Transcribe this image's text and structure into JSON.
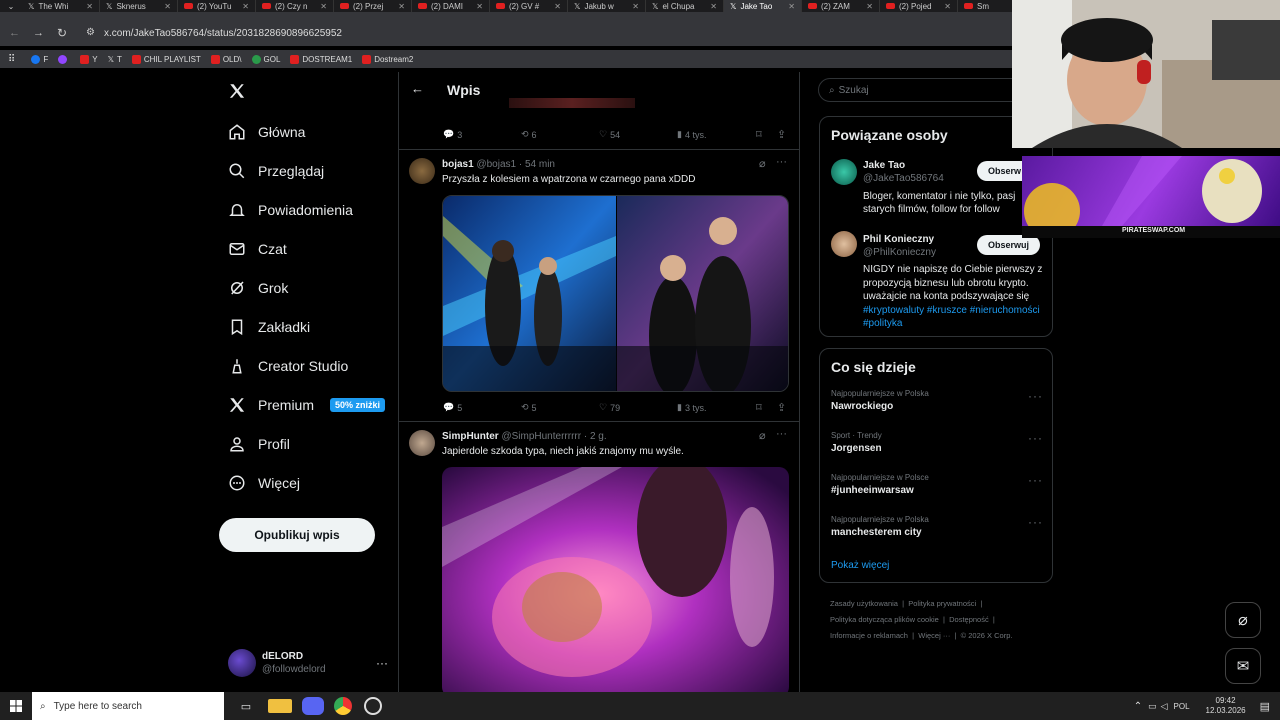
{
  "browser": {
    "tabs": [
      {
        "label": "The Whi",
        "icon": "x-icon"
      },
      {
        "label": "Sknerus",
        "icon": "x-icon"
      },
      {
        "label": "(2) YouTu",
        "icon": "youtube-icon"
      },
      {
        "label": "(2) Czy n",
        "icon": "youtube-icon"
      },
      {
        "label": "(2) Przej",
        "icon": "youtube-icon"
      },
      {
        "label": "(2) DAMI",
        "icon": "youtube-icon"
      },
      {
        "label": "(2) GV #",
        "icon": "youtube-icon"
      },
      {
        "label": "Jakub w",
        "icon": "x-icon"
      },
      {
        "label": "el Chupa",
        "icon": "x-icon"
      },
      {
        "label": "Jake Tao",
        "icon": "x-icon",
        "active": true
      },
      {
        "label": "(2) ZAM",
        "icon": "youtube-icon"
      },
      {
        "label": "(2) Pojed",
        "icon": "youtube-icon"
      },
      {
        "label": "Sm",
        "icon": "youtube-icon"
      }
    ],
    "url": "x.com/JakeTao586764/status/2031828690896625952",
    "bookmarks": [
      {
        "label": "F",
        "icon": "facebook-icon"
      },
      {
        "label": "",
        "icon": "twitch-icon"
      },
      {
        "label": "Y",
        "icon": "youtube-icon"
      },
      {
        "label": "T",
        "icon": "x-icon"
      },
      {
        "label": "CHIL PLAYLIST",
        "icon": "youtube-icon"
      },
      {
        "label": "OLD\\",
        "icon": "youtube-icon"
      },
      {
        "label": "GOL",
        "icon": "gol-icon"
      },
      {
        "label": "DOSTREAM1",
        "icon": "youtube-icon"
      },
      {
        "label": "Dostream2",
        "icon": "youtube-icon"
      }
    ]
  },
  "nav": {
    "items": [
      {
        "label": "Główna",
        "icon": "home-icon"
      },
      {
        "label": "Przeglądaj",
        "icon": "search-icon"
      },
      {
        "label": "Powiadomienia",
        "icon": "bell-icon"
      },
      {
        "label": "Czat",
        "icon": "mail-icon"
      },
      {
        "label": "Grok",
        "icon": "grok-icon"
      },
      {
        "label": "Zakładki",
        "icon": "bookmark-icon"
      },
      {
        "label": "Creator Studio",
        "icon": "creator-icon"
      },
      {
        "label": "Premium",
        "icon": "x-logo-icon",
        "badge": "50% zniżki"
      },
      {
        "label": "Profil",
        "icon": "person-icon"
      },
      {
        "label": "Więcej",
        "icon": "more-circle-icon"
      }
    ],
    "post_button": "Opublikuj wpis",
    "account": {
      "name": "dELORD",
      "handle": "@followdelord"
    }
  },
  "header": {
    "title": "Wpis"
  },
  "tweets": [
    {
      "replies": "3",
      "reposts": "6",
      "likes": "54",
      "views": "4 tys."
    },
    {
      "name": "bojas1",
      "handle": "@bojas1",
      "time": "· 54 min",
      "text": "Przyszła z kolesiem a wpatrzona w czarnego pana xDDD",
      "replies": "5",
      "reposts": "5",
      "likes": "79",
      "views": "3 tys."
    },
    {
      "name": "SimpHunter",
      "handle": "@SimpHunterrrrrr",
      "time": "· 2 g.",
      "text": "Japierdole szkoda typa, niech jakiś znajomy mu wyśle."
    }
  ],
  "search": {
    "placeholder": "Szukaj"
  },
  "related": {
    "title": "Powiązane osoby",
    "people": [
      {
        "name": "Jake Tao",
        "handle": "@JakeTao586764",
        "button": "Obserw",
        "bio": "Bloger, komentator i nie tylko, pasj starych filmów, follow for follow"
      },
      {
        "name": "Phil Konieczny",
        "handle": "@PhilKonieczny",
        "button": "Obserwuj",
        "bio": "NIGDY nie napiszę do Ciebie pierwszy z propozycją biznesu lub obrotu krypto. uważajcie na konta podszywające się",
        "tags": "#kryptowaluty #kruszce #nieruchomości #polityka"
      }
    ]
  },
  "trends": {
    "title": "Co się dzieje",
    "items": [
      {
        "context": "Najpopularniejsze w Polska",
        "name": "Nawrockiego"
      },
      {
        "context": "Sport · Trendy",
        "name": "Jorgensen"
      },
      {
        "context": "Najpopularniejsze w Polsce",
        "name": "#junheeinwarsaw"
      },
      {
        "context": "Najpopularniejsze w Polska",
        "name": "manchesterem city"
      }
    ],
    "show_more": "Pokaż więcej"
  },
  "footer": {
    "links": [
      "Zasady użytkowania",
      "Polityka prywatności",
      "Polityka dotycząca plików cookie",
      "Dostępność",
      "Informacje o reklamach",
      "Więcej ···",
      "© 2026 X Corp."
    ]
  },
  "overlay": {
    "banner_text": "PIRATESWAP.COM"
  },
  "taskbar": {
    "search_placeholder": "Type here to search",
    "lang": "POL",
    "time": "09:42",
    "date": "12.03.2026"
  },
  "colors": {
    "accent": "#1d9bf0",
    "background": "#000000",
    "border": "#2f3336"
  }
}
